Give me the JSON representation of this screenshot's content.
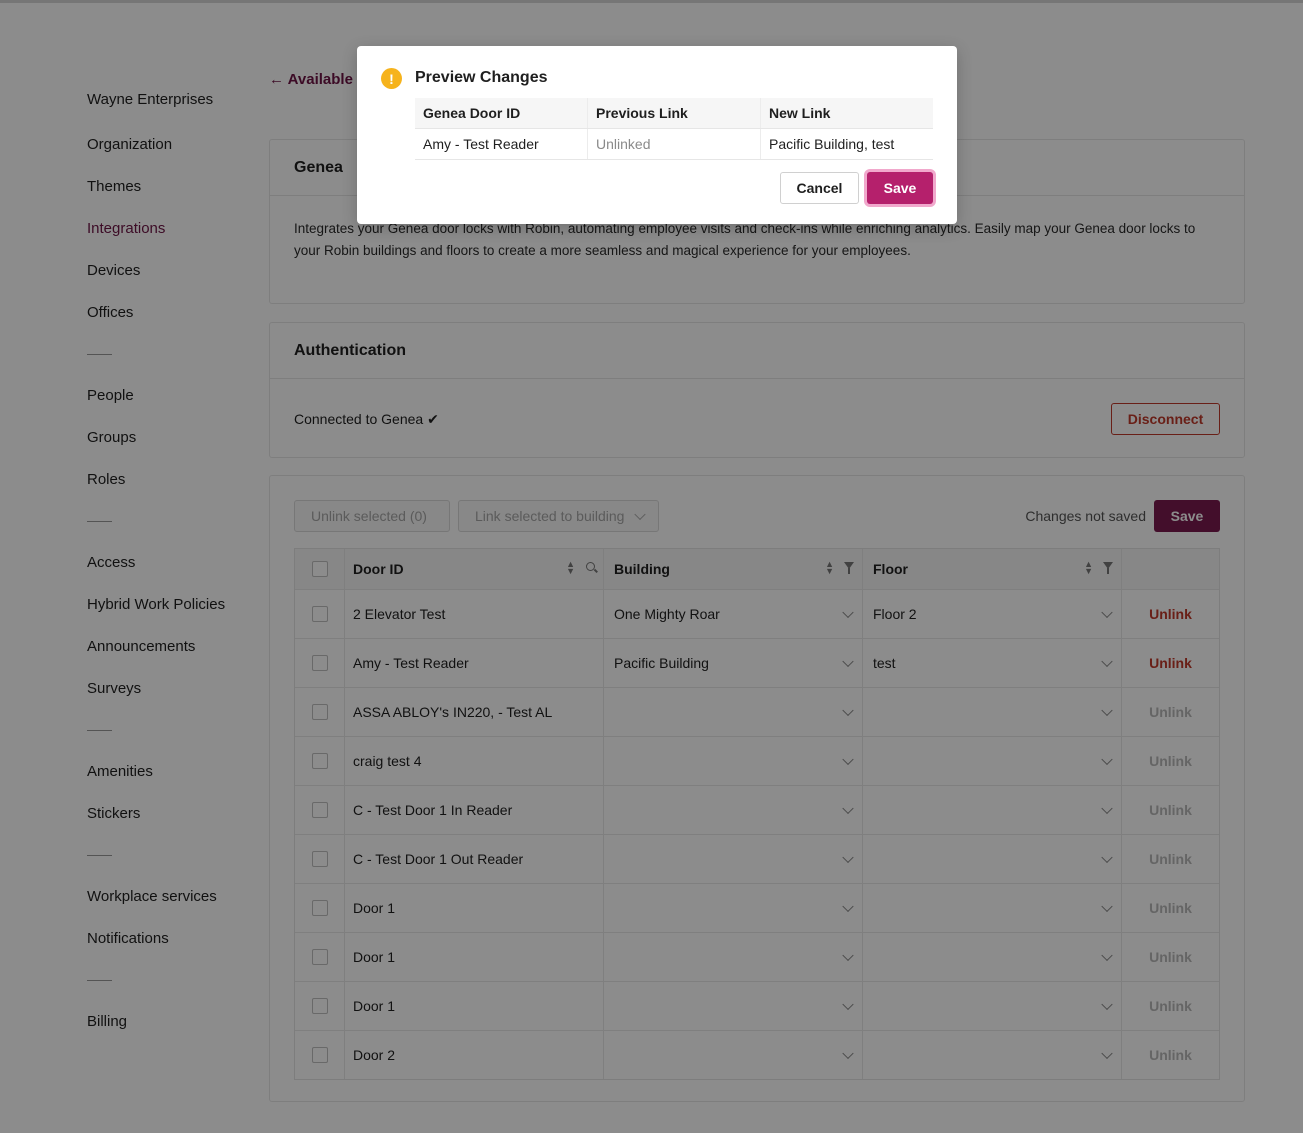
{
  "sidebar": {
    "org_name": "Wayne Enterprises",
    "items": [
      {
        "label": "Organization"
      },
      {
        "label": "Themes"
      },
      {
        "label": "Integrations"
      },
      {
        "label": "Devices"
      },
      {
        "label": "Offices"
      },
      {
        "label": "People"
      },
      {
        "label": "Groups"
      },
      {
        "label": "Roles"
      },
      {
        "label": "Access"
      },
      {
        "label": "Hybrid Work Policies"
      },
      {
        "label": "Announcements"
      },
      {
        "label": "Surveys"
      },
      {
        "label": "Amenities"
      },
      {
        "label": "Stickers"
      },
      {
        "label": "Workplace services"
      },
      {
        "label": "Notifications"
      },
      {
        "label": "Billing"
      }
    ]
  },
  "back_link": "← Available",
  "genea_card": {
    "title": "Genea",
    "description": "Integrates your Genea door locks with Robin, automating employee visits and check-ins while enriching analytics. Easily map your Genea door locks to your Robin buildings and floors to create a more seamless and magical experience for your employees."
  },
  "auth_card": {
    "title": "Authentication",
    "status": "Connected to Genea ✔",
    "disconnect_label": "Disconnect"
  },
  "toolbar": {
    "unlink_selected": "Unlink selected (0)",
    "link_selected": "Link selected to building",
    "changes_status": "Changes not saved",
    "save_label": "Save"
  },
  "table": {
    "headers": {
      "door_id": "Door ID",
      "building": "Building",
      "floor": "Floor"
    },
    "unlink_label": "Unlink",
    "rows": [
      {
        "door": "2 Elevator Test",
        "building": "One Mighty Roar",
        "floor": "Floor 2",
        "linked": true
      },
      {
        "door": "Amy - Test Reader",
        "building": "Pacific Building",
        "floor": "test",
        "linked": true
      },
      {
        "door": "ASSA ABLOY's IN220, - Test AL",
        "building": "",
        "floor": "",
        "linked": false
      },
      {
        "door": "craig test 4",
        "building": "",
        "floor": "",
        "linked": false
      },
      {
        "door": "C - Test Door 1 In Reader",
        "building": "",
        "floor": "",
        "linked": false
      },
      {
        "door": "C - Test Door 1 Out Reader",
        "building": "",
        "floor": "",
        "linked": false
      },
      {
        "door": "Door 1",
        "building": "",
        "floor": "",
        "linked": false
      },
      {
        "door": "Door 1",
        "building": "",
        "floor": "",
        "linked": false
      },
      {
        "door": "Door 1",
        "building": "",
        "floor": "",
        "linked": false
      },
      {
        "door": "Door 2",
        "building": "",
        "floor": "",
        "linked": false
      }
    ]
  },
  "modal": {
    "title": "Preview Changes",
    "warning_icon": "!",
    "headers": [
      "Genea Door ID",
      "Previous Link",
      "New Link"
    ],
    "rows": [
      {
        "door": "Amy - Test Reader",
        "previous": "Unlinked",
        "new": "Pacific Building, test"
      }
    ],
    "cancel_label": "Cancel",
    "save_label": "Save"
  },
  "colors": {
    "accent": "#6e1545",
    "save_button": "#b5206c",
    "danger": "#c0392b",
    "warning": "#f6b31c"
  }
}
